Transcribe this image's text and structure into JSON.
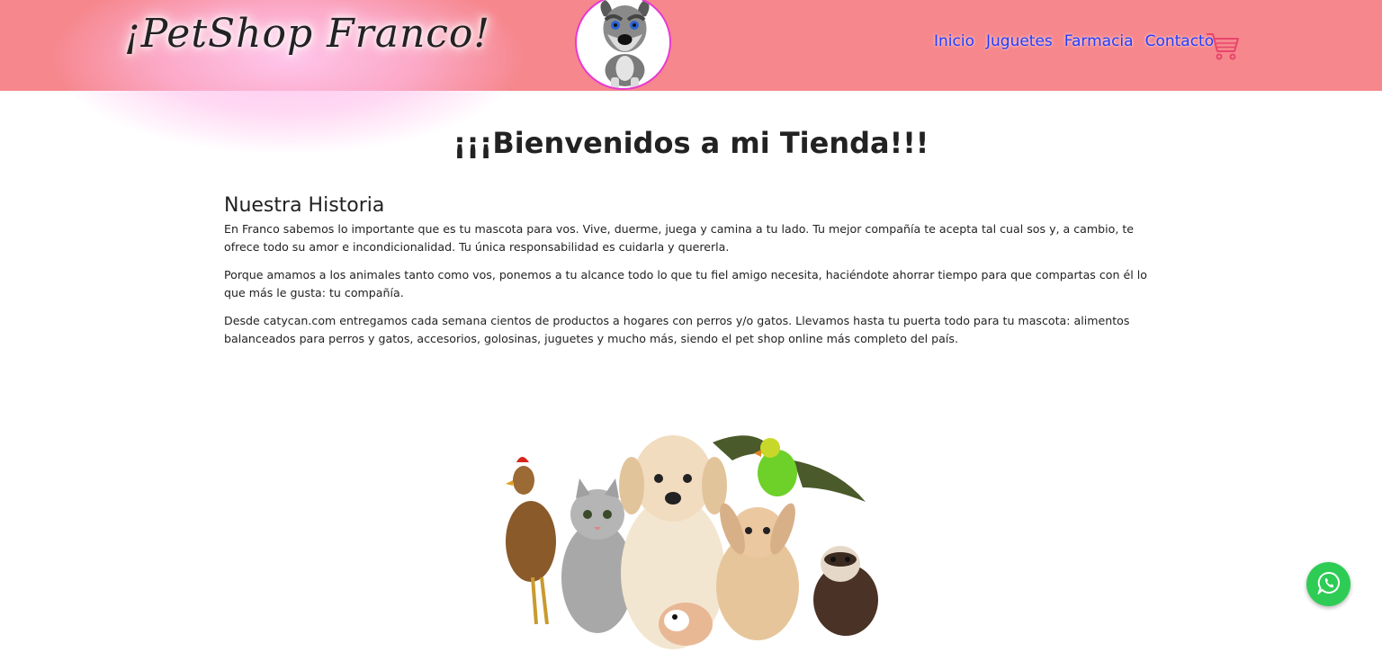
{
  "header": {
    "brand": "¡PetShop Franco!",
    "logo_icon": "schnauzer-dog-logo",
    "nav": [
      "Inicio",
      "Juguetes",
      "Farmacia",
      "Contacto"
    ],
    "cart_icon": "shopping-cart-icon"
  },
  "main": {
    "title": "¡¡¡Bienvenidos a mi Tienda!!!",
    "section_title": "Nuestra Historia",
    "paragraphs": [
      "En Franco sabemos lo importante que es tu mascota para vos. Vive, duerme, juega y camina a tu lado. Tu mejor compañía te acepta tal cual sos y, a cambio, te ofrece todo su amor e incondicionalidad. Tu única responsabilidad es cuidarla y quererla.",
      "Porque amamos a los animales tanto como vos, ponemos a tu alcance todo lo que tu fiel amigo necesita, haciéndote ahorrar tiempo para que compartas con él lo que más le gusta: tu compañía.",
      "Desde catycan.com entregamos cada semana cientos de productos a hogares con perros y/o gatos. Llevamos hasta tu puerta todo para tu mascota: alimentos balanceados para perros y gatos, accesorios, golosinas, juguetes y mucho más, siendo el pet shop online más completo del país."
    ],
    "hero_image_icon": "pets-group-image"
  },
  "whatsapp_icon": "whatsapp-icon",
  "colors": {
    "header_bg": "#f6878d",
    "nav_link": "#1f3cff",
    "logo_border": "#e83ad0",
    "cart": "#e8456a",
    "whatsapp": "#2ecc55"
  }
}
